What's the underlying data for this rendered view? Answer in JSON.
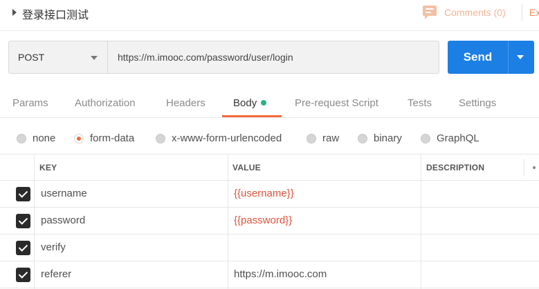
{
  "title_bar": {
    "request_name": "登录接口测试",
    "comments_label": "Comments (0)",
    "cut_label": "Ex"
  },
  "request": {
    "method": "POST",
    "url": "https://m.imooc.com/password/user/login",
    "send_label": "Send"
  },
  "tabs": [
    {
      "label": "Params"
    },
    {
      "label": "Authorization"
    },
    {
      "label": "Headers"
    },
    {
      "label": "Body"
    },
    {
      "label": "Pre-request Script"
    },
    {
      "label": "Tests"
    },
    {
      "label": "Settings"
    }
  ],
  "active_tab": "Body",
  "body_types": [
    {
      "label": "none",
      "selected": false
    },
    {
      "label": "form-data",
      "selected": true
    },
    {
      "label": "x-www-form-urlencoded",
      "selected": false
    },
    {
      "label": "raw",
      "selected": false
    },
    {
      "label": "binary",
      "selected": false
    },
    {
      "label": "GraphQL",
      "selected": false
    }
  ],
  "table": {
    "headers": {
      "key": "KEY",
      "value": "VALUE",
      "description": "DESCRIPTION"
    },
    "rows": [
      {
        "checked": true,
        "key": "username",
        "value": "{{username}}",
        "value_is_variable": true,
        "description": ""
      },
      {
        "checked": true,
        "key": "password",
        "value": "{{password}}",
        "value_is_variable": true,
        "description": ""
      },
      {
        "checked": true,
        "key": "verify",
        "value": "",
        "value_is_variable": false,
        "description": ""
      },
      {
        "checked": true,
        "key": "referer",
        "value": "https://m.imooc.com",
        "value_is_variable": false,
        "description": ""
      }
    ]
  },
  "colors": {
    "accent": "#f26b3a",
    "send_button": "#1b7fe4",
    "active_dot": "#26b47f",
    "variable_text": "#e0533d",
    "comments_text": "#f3b496"
  },
  "icons": {
    "expand": "caret-right-icon",
    "comments": "comment-icon",
    "method_dropdown": "chevron-down-icon",
    "send_dropdown": "chevron-down-icon",
    "checkbox": "checkmark-icon",
    "more": "more-dots-icon"
  }
}
